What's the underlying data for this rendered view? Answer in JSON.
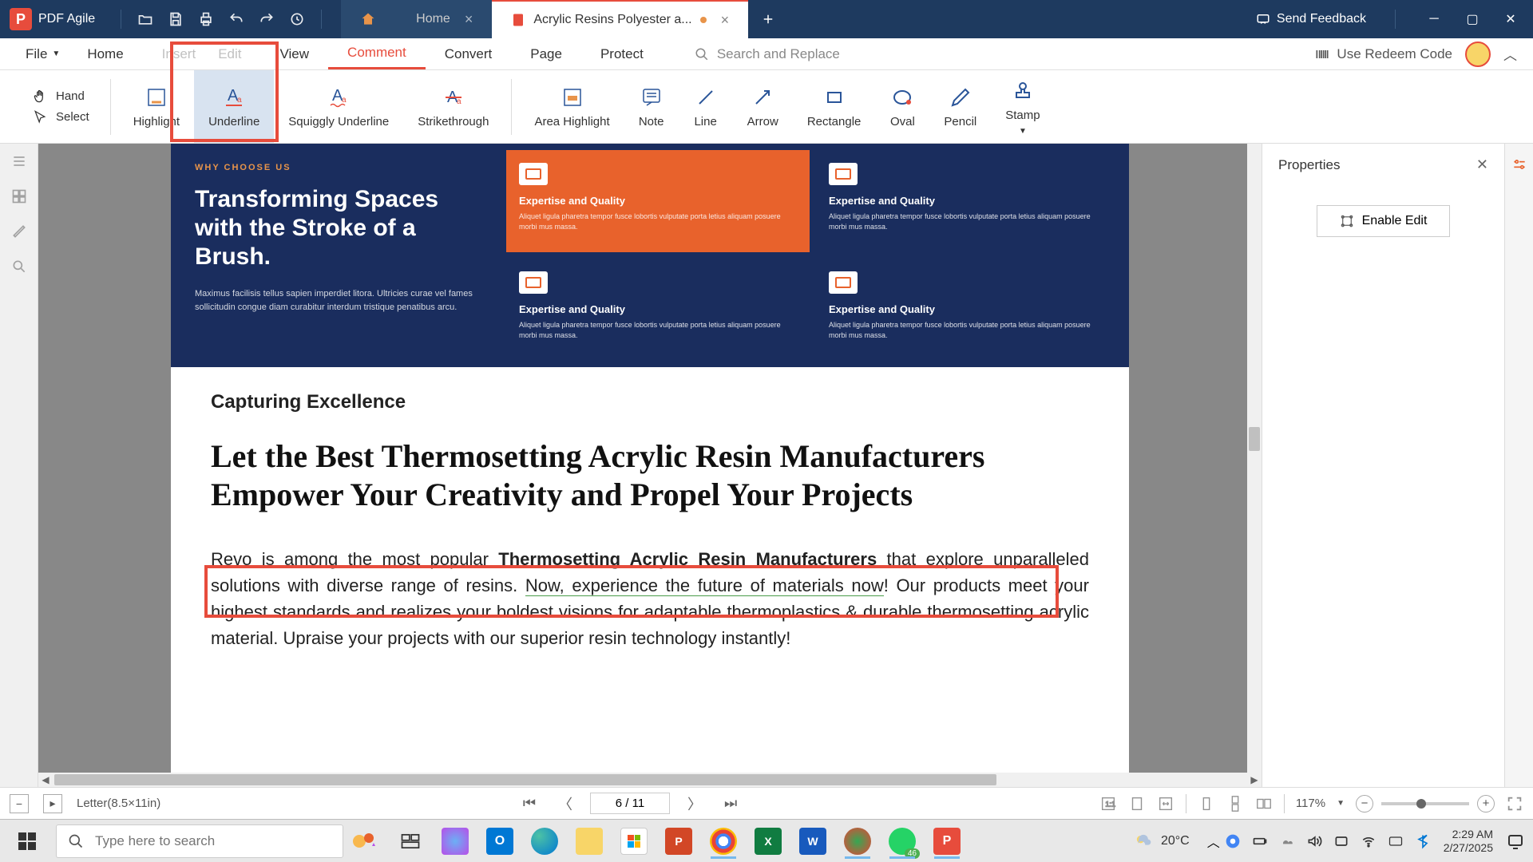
{
  "app": {
    "name": "PDF Agile"
  },
  "tabs": {
    "home": "Home",
    "doc": "Acrylic Resins  Polyester a..."
  },
  "titlebar": {
    "feedback": "Send Feedback"
  },
  "menu": {
    "file": "File",
    "home": "Home",
    "insert": "Insert",
    "edit": "Edit",
    "view": "View",
    "comment": "Comment",
    "convert": "Convert",
    "page": "Page",
    "protect": "Protect",
    "search_placeholder": "Search and Replace",
    "redeem": "Use Redeem Code"
  },
  "ribbon": {
    "hand": "Hand",
    "select": "Select",
    "highlight": "Highlight",
    "underline": "Underline",
    "squiggly": "Squiggly Underline",
    "strikethrough": "Strikethrough",
    "area_highlight": "Area Highlight",
    "note": "Note",
    "line": "Line",
    "arrow": "Arrow",
    "rectangle": "Rectangle",
    "oval": "Oval",
    "pencil": "Pencil",
    "stamp": "Stamp"
  },
  "properties": {
    "title": "Properties",
    "enable_edit": "Enable Edit"
  },
  "document": {
    "hero_tag": "WHY CHOOSE US",
    "hero_title": "Transforming Spaces with the Stroke of a Brush.",
    "hero_text": "Maximus facilisis tellus sapien imperdiet litora. Ultricies curae vel fames sollicitudin congue diam curabitur interdum tristique penatibus arcu.",
    "card_title": "Expertise and Quality",
    "card_text": "Aliquet ligula pharetra tempor fusce lobortis vulputate porta letius aliquam posuere morbi mus massa.",
    "section_title": "Capturing Excellence",
    "main_heading": "Let the Best Thermosetting Acrylic Resin Manufacturers Empower Your Creativity and Propel Your Projects",
    "body_p1_a": "Revo is among the most popular ",
    "body_p1_b": "Thermosetting Acrylic Resin Manufacturers",
    "body_p1_c": " that explore unparalleled solutions with diverse range of resins. ",
    "body_p1_d": "Now, experience the future of materials now",
    "body_p1_e": "! Our products meet your highest standards and realizes your boldest visions for adaptable thermoplastics & durable thermosetting acrylic material. Upraise your projects with our superior resin technology instantly!"
  },
  "status": {
    "page_size": "Letter(8.5×11in)",
    "page": "6 / 11",
    "zoom": "117%"
  },
  "taskbar": {
    "search_placeholder": "Type here to search",
    "weather_temp": "20°C",
    "wa_badge": "46",
    "time": "2:29 AM",
    "date": "2/27/2025"
  }
}
